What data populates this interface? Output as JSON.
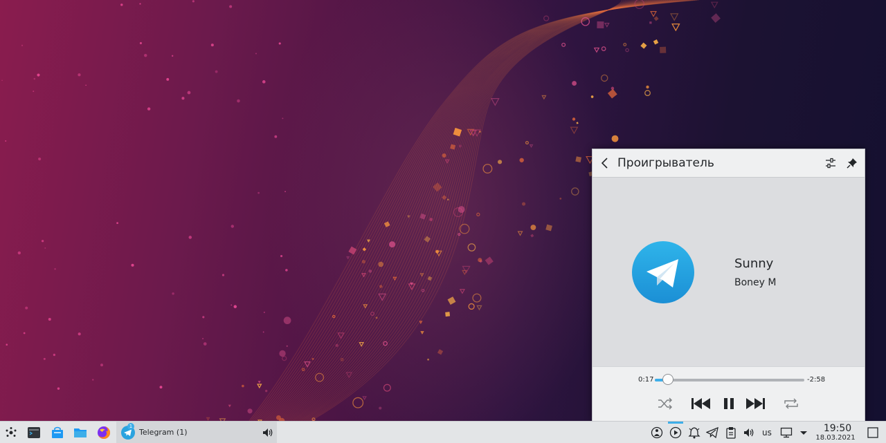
{
  "player": {
    "title": "Проигрыватель",
    "track_title": "Sunny",
    "artist": "Boney M",
    "elapsed": "0:17",
    "remaining": "-2:58",
    "progress_fraction": 0.09,
    "album_art_icon": "telegram-icon"
  },
  "taskbar": {
    "telegram_task_label": "Telegram (1)",
    "telegram_badge": "1",
    "keyboard_layout": "us",
    "clock_time": "19:50",
    "clock_date": "18.03.2021"
  },
  "colors": {
    "accent": "#3daee9",
    "telegram_blue": "#2aa3df",
    "popup_background": "#dcdde0",
    "taskbar_background": "#e3e5e7"
  }
}
